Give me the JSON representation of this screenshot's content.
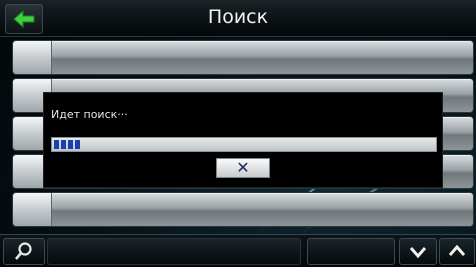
{
  "header": {
    "title": "Поиск"
  },
  "dialog": {
    "status": "Идет поиск···",
    "progress": 0.09,
    "cancel_label": "✕"
  },
  "list": {
    "rows": [
      "",
      "",
      "",
      "",
      ""
    ]
  },
  "icons": {
    "back": "back-arrow-icon",
    "search": "magnifier-icon",
    "down": "chevron-down-icon",
    "up": "chevron-up-icon",
    "cancel": "close-icon"
  },
  "colors": {
    "accent_green": "#3fcf3f",
    "progress_blue": "#1b3fb0"
  }
}
